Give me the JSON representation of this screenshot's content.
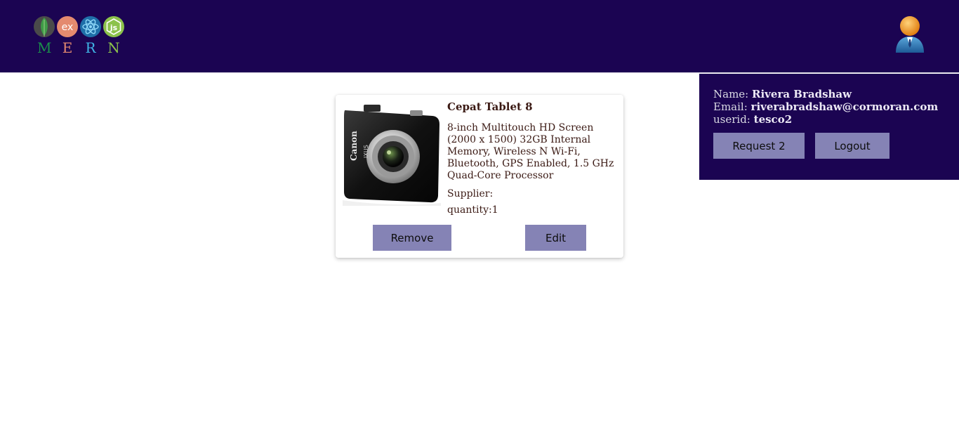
{
  "header": {
    "logo": {
      "letters": [
        "M",
        "E",
        "R",
        "N"
      ],
      "icons": [
        "mongodb-leaf-icon",
        "express-icon",
        "react-icon",
        "nodejs-icon"
      ]
    },
    "avatar_icon": "user-avatar-icon"
  },
  "user_panel": {
    "name_label": "Name:",
    "name_value": "Rivera Bradshaw",
    "email_label": "Email:",
    "email_value": "riverabradshaw@cormoran.com",
    "userid_label": "userid:",
    "userid_value": "tesco2",
    "request_button": "Request 2",
    "logout_button": "Logout"
  },
  "product": {
    "title": "Cepat Tablet 8",
    "description": "8-inch Multitouch HD Screen (2000 x 1500) 32GB Internal Memory, Wireless N Wi-Fi, Bluetooth, GPS Enabled, 1.5 GHz Quad-Core Processor",
    "supplier": "Supplier:",
    "quantity": "quantity:1",
    "image_alt": "camera-product-image",
    "camera_brand": "Canon",
    "camera_model": "IXUS",
    "remove_button": "Remove",
    "edit_button": "Edit"
  },
  "colors": {
    "header_bg": "#1b0452",
    "button_bg": "#8583b5",
    "text_dark": "#3b1a14",
    "logo_m": "#1a8f4a",
    "logo_e": "#e48a6f",
    "logo_r": "#3fb4e6",
    "logo_n": "#8cc24b"
  }
}
